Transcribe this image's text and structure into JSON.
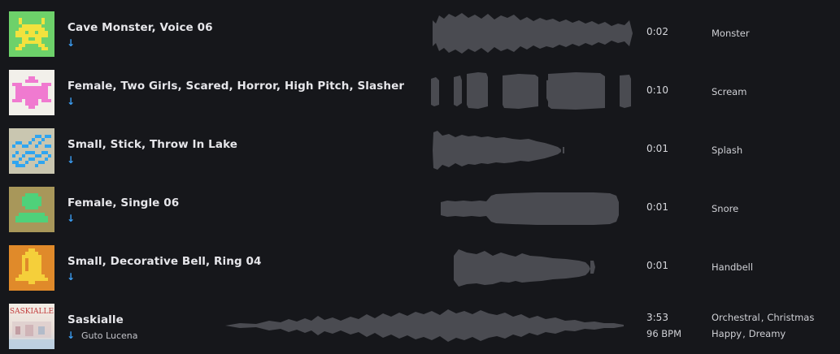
{
  "colors": {
    "background": "#16171b",
    "accent": "#3b9cf0",
    "waveform": "#4a4b51"
  },
  "tracks": [
    {
      "title": "Cave Monster, Voice 06",
      "download_icon": "arrow-down-icon",
      "duration": "0:02",
      "tags": [
        "Monster"
      ]
    },
    {
      "title": "Female, Two Girls, Scared, Horror, High Pitch, Slasher",
      "download_icon": "arrow-down-icon",
      "duration": "0:10",
      "tags": [
        "Scream"
      ]
    },
    {
      "title": "Small, Stick, Throw In Lake",
      "download_icon": "arrow-down-icon",
      "duration": "0:01",
      "tags": [
        "Splash"
      ]
    },
    {
      "title": "Female, Single 06",
      "download_icon": "arrow-down-icon",
      "duration": "0:01",
      "tags": [
        "Snore"
      ]
    },
    {
      "title": "Small, Decorative Bell, Ring 04",
      "download_icon": "arrow-down-icon",
      "duration": "0:01",
      "tags": [
        "Handbell"
      ]
    },
    {
      "title": "Saskialle",
      "artist": "Guto Lucena",
      "download_icon": "arrow-down-icon",
      "duration": "3:53",
      "bpm": "96 BPM",
      "tags": [
        "Orchestral",
        "Christmas"
      ],
      "tags_row2": [
        "Happy",
        "Dreamy"
      ],
      "cover_text": "SASKIALLE"
    }
  ],
  "separator": ","
}
